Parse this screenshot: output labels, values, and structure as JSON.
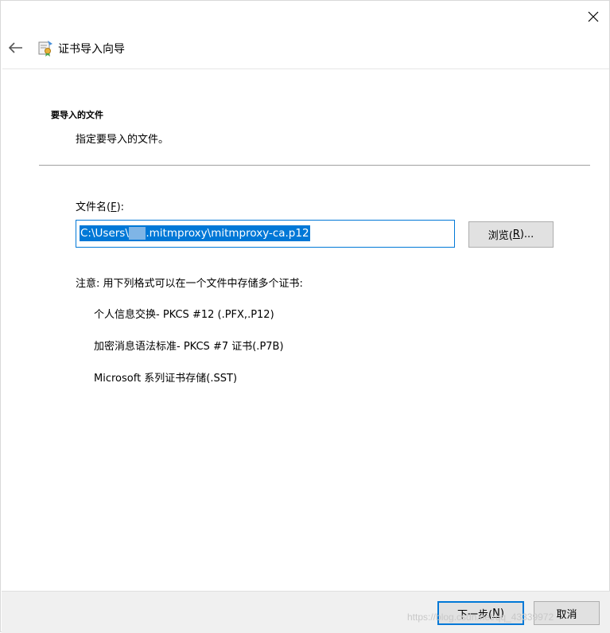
{
  "window": {
    "close_glyph": "✕"
  },
  "wizard": {
    "title": "证书导入向导"
  },
  "section": {
    "heading": "要导入的文件",
    "description": "指定要导入的文件。"
  },
  "file": {
    "label_prefix": "文件名(",
    "label_key": "F",
    "label_suffix": "):",
    "value_part1": "C:\\Users\\",
    "value_redacted": "     ",
    "value_part2": ".mitmproxy\\mitmproxy-ca.p12"
  },
  "browse_button": {
    "prefix": "浏览(",
    "key": "R",
    "suffix": ")..."
  },
  "note": "注意: 用下列格式可以在一个文件中存储多个证书:",
  "formats": [
    "个人信息交换- PKCS #12 (.PFX,.P12)",
    "加密消息语法标准- PKCS #7 证书(.P7B)",
    "Microsoft 系列证书存储(.SST)"
  ],
  "footer": {
    "next_prefix": "下一步(",
    "next_key": "N",
    "next_suffix": ")",
    "cancel": "取消"
  },
  "watermark": "https://blog.csdn.net/qq_43339972",
  "colors": {
    "accent": "#0078d7",
    "button_bg": "#e1e1e1",
    "footer_bg": "#f0f0f0"
  },
  "icons": {
    "back": "back-arrow-icon",
    "wizard": "certificate-icon",
    "close": "close-icon"
  }
}
